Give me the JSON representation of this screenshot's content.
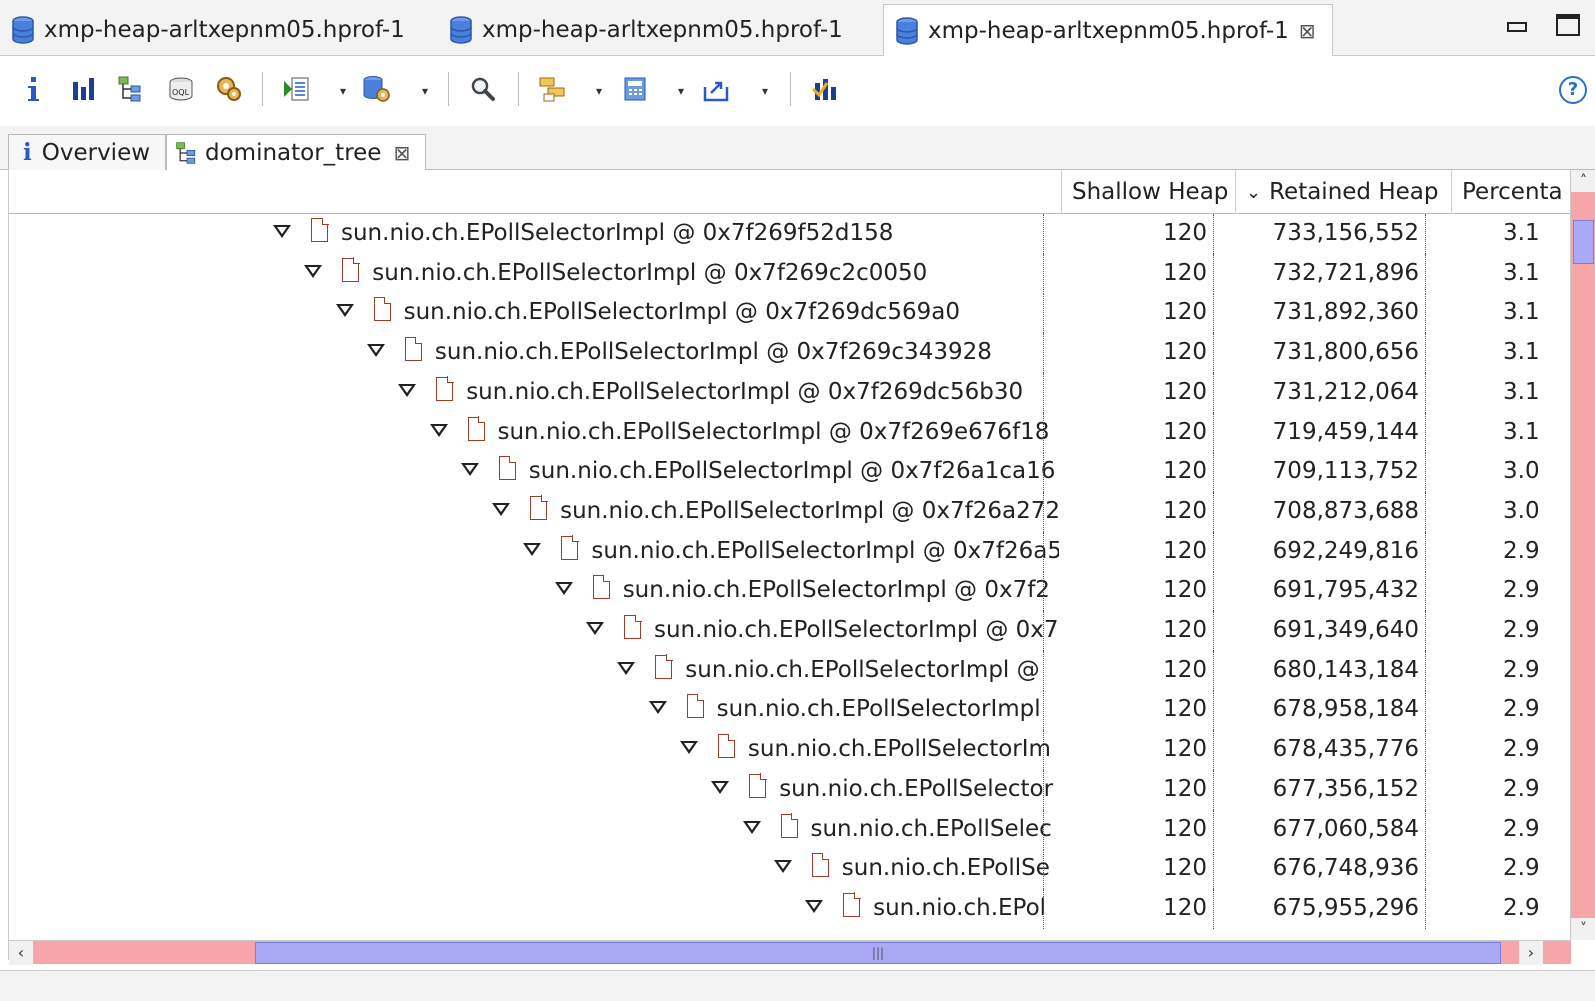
{
  "editor_tabs": [
    {
      "label": "xmp-heap-arltxepnm05.hprof-1",
      "active": false
    },
    {
      "label": "xmp-heap-arltxepnm05.hprof-1",
      "active": false
    },
    {
      "label": "xmp-heap-arltxepnm05.hprof-1",
      "active": true,
      "close": "⊠"
    }
  ],
  "toolbar": {
    "help_glyph": "?",
    "icons": [
      "info-icon",
      "histogram-icon",
      "dominator-tree-icon",
      "oql-icon",
      "thread-overview-icon",
      "run-report-icon",
      "heap-dump-queries-icon",
      "search-icon",
      "group-by-icon",
      "calculate-retained-icon",
      "export-icon",
      "query-browser-icon"
    ]
  },
  "view_tabs": [
    {
      "label": "Overview",
      "active": false
    },
    {
      "label": "dominator_tree",
      "active": true,
      "close": "⊠"
    }
  ],
  "table": {
    "columns": {
      "shallow": "Shallow Heap",
      "retained": "Retained Heap",
      "retained_sort": "⌄",
      "percentage": "Percenta"
    },
    "rows": [
      {
        "label": "sun.nio.ch.EPollSelectorImpl @ 0x7f269f52d158",
        "shallow": "120",
        "retained": "733,156,552",
        "pct": "3.1"
      },
      {
        "label": "sun.nio.ch.EPollSelectorImpl @ 0x7f269c2c0050",
        "shallow": "120",
        "retained": "732,721,896",
        "pct": "3.1"
      },
      {
        "label": "sun.nio.ch.EPollSelectorImpl @ 0x7f269dc569a0",
        "shallow": "120",
        "retained": "731,892,360",
        "pct": "3.1"
      },
      {
        "label": "sun.nio.ch.EPollSelectorImpl @ 0x7f269c343928",
        "shallow": "120",
        "retained": "731,800,656",
        "pct": "3.1"
      },
      {
        "label": "sun.nio.ch.EPollSelectorImpl @ 0x7f269dc56b30",
        "shallow": "120",
        "retained": "731,212,064",
        "pct": "3.1"
      },
      {
        "label": "sun.nio.ch.EPollSelectorImpl @ 0x7f269e676f18",
        "shallow": "120",
        "retained": "719,459,144",
        "pct": "3.1"
      },
      {
        "label": "sun.nio.ch.EPollSelectorImpl @ 0x7f26a1ca16",
        "shallow": "120",
        "retained": "709,113,752",
        "pct": "3.0"
      },
      {
        "label": "sun.nio.ch.EPollSelectorImpl @ 0x7f26a272",
        "shallow": "120",
        "retained": "708,873,688",
        "pct": "3.0"
      },
      {
        "label": "sun.nio.ch.EPollSelectorImpl @ 0x7f26a5",
        "shallow": "120",
        "retained": "692,249,816",
        "pct": "2.9"
      },
      {
        "label": "sun.nio.ch.EPollSelectorImpl @ 0x7f2",
        "shallow": "120",
        "retained": "691,795,432",
        "pct": "2.9"
      },
      {
        "label": "sun.nio.ch.EPollSelectorImpl @ 0x7",
        "shallow": "120",
        "retained": "691,349,640",
        "pct": "2.9"
      },
      {
        "label": "sun.nio.ch.EPollSelectorImpl @",
        "shallow": "120",
        "retained": "680,143,184",
        "pct": "2.9"
      },
      {
        "label": "sun.nio.ch.EPollSelectorImpl",
        "shallow": "120",
        "retained": "678,958,184",
        "pct": "2.9"
      },
      {
        "label": "sun.nio.ch.EPollSelectorIm",
        "shallow": "120",
        "retained": "678,435,776",
        "pct": "2.9"
      },
      {
        "label": "sun.nio.ch.EPollSelector",
        "shallow": "120",
        "retained": "677,356,152",
        "pct": "2.9"
      },
      {
        "label": "sun.nio.ch.EPollSelec",
        "shallow": "120",
        "retained": "677,060,584",
        "pct": "2.9"
      },
      {
        "label": "sun.nio.ch.EPollSe",
        "shallow": "120",
        "retained": "676,748,936",
        "pct": "2.9"
      },
      {
        "label": "sun.nio.ch.EPol",
        "shallow": "120",
        "retained": "675,955,296",
        "pct": "2.9"
      }
    ]
  },
  "colors": {
    "scroll_track": "#f6a5a8",
    "scroll_thumb": "#a9a9f5",
    "file_icon": "#a03d2a",
    "db_icon": "#3b6fd1"
  }
}
